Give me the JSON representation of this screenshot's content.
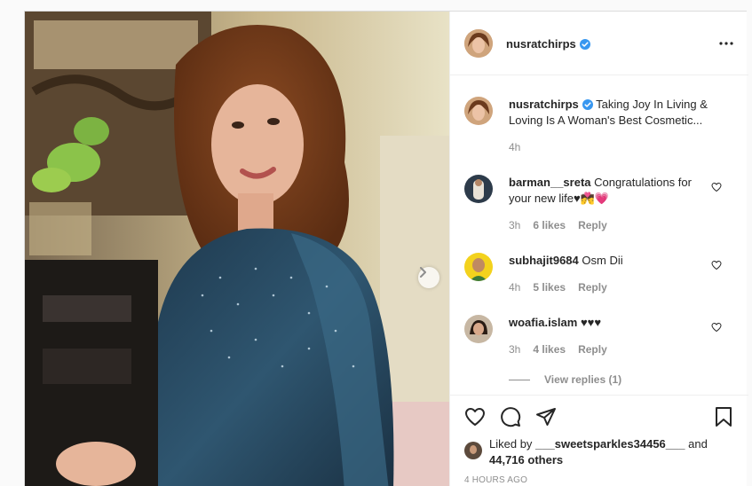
{
  "post": {
    "username": "nusratchirps",
    "more_label": "•••"
  },
  "caption": {
    "username": "nusratchirps",
    "text": "Taking Joy In Living & Loving Is A Woman's Best Cosmetic...",
    "time": "4h"
  },
  "comments": [
    {
      "username": "barman__sreta",
      "text": "Congratulations for your new life♥💏💗",
      "time": "3h",
      "likes": "6 likes",
      "reply": "Reply"
    },
    {
      "username": "subhajit9684",
      "text": "Osm Dii",
      "time": "4h",
      "likes": "5 likes",
      "reply": "Reply"
    },
    {
      "username": "woafia.islam",
      "text": "♥♥♥",
      "time": "3h",
      "likes": "4 likes",
      "reply": "Reply"
    }
  ],
  "view_replies": "View replies (1)",
  "likes": {
    "prefix": "Liked by",
    "user": "___sweetsparkles34456___",
    "joiner": "and",
    "others": "44,716 others"
  },
  "timestamp": "4 HOURS AGO",
  "icons": {
    "like": "heart-icon",
    "comment": "comment-icon",
    "share": "share-icon",
    "save": "bookmark-icon",
    "verified": "verified-badge-icon",
    "next": "chevron-right-icon",
    "more": "more-options-icon"
  },
  "colors": {
    "verified_blue": "#3897f0",
    "text": "#262626",
    "muted": "#8e8e8e",
    "border": "#efefef"
  }
}
